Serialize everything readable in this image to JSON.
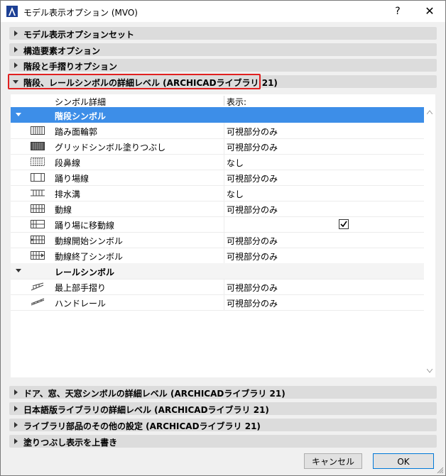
{
  "window": {
    "title": "モデル表示オプション (MVO)",
    "help_label": "?",
    "close_label": "✕",
    "app_icon": "archicad-logo-icon"
  },
  "sections_top": [
    {
      "label": "モデル表示オプションセット"
    },
    {
      "label": "構造要素オプション"
    },
    {
      "label": "階段と手摺りオプション"
    },
    {
      "label": "階段、レールシンボルの詳細レベル (ARCHICADライブラリ 21)"
    }
  ],
  "table": {
    "col_symbol": "シンボル詳細",
    "col_display": "表示:",
    "group_stairs": "階段シンボル",
    "group_rails": "レールシンボル",
    "stair_rows": [
      {
        "name": "踏み面輪郭",
        "value": "可視部分のみ",
        "icon": "tread-outline-icon"
      },
      {
        "name": "グリッドシンボル塗りつぶし",
        "value": "可視部分のみ",
        "icon": "grid-fill-icon"
      },
      {
        "name": "段鼻線",
        "value": "なし",
        "icon": "nosing-line-icon"
      },
      {
        "name": "踊り場線",
        "value": "可視部分のみ",
        "icon": "landing-line-icon"
      },
      {
        "name": "排水溝",
        "value": "なし",
        "icon": "drain-icon"
      },
      {
        "name": "動線",
        "value": "可視部分のみ",
        "icon": "walking-line-icon"
      },
      {
        "name": "踊り場に移動線",
        "value": "",
        "icon": "landing-walk-icon",
        "checked": true
      },
      {
        "name": "動線開始シンボル",
        "value": "可視部分のみ",
        "icon": "walk-start-icon"
      },
      {
        "name": "動線終了シンボル",
        "value": "可視部分のみ",
        "icon": "walk-end-icon"
      }
    ],
    "rail_rows": [
      {
        "name": "最上部手摺り",
        "value": "可視部分のみ",
        "icon": "top-rail-icon"
      },
      {
        "name": "ハンドレール",
        "value": "可視部分のみ",
        "icon": "handrail-icon"
      }
    ]
  },
  "sections_bottom": [
    {
      "label": "ドア、窓、天窓シンボルの詳細レベル (ARCHICADライブラリ 21)"
    },
    {
      "label": "日本語版ライブラリの詳細レベル (ARCHICADライブラリ 21)"
    },
    {
      "label": "ライブラリ部品のその他の設定 (ARCHICADライブラリ 21)"
    },
    {
      "label": "塗りつぶし表示を上書き"
    }
  ],
  "buttons": {
    "cancel": "キャンセル",
    "ok": "OK"
  },
  "colors": {
    "selection": "#3d8ee8",
    "highlight_border": "#e02020"
  }
}
